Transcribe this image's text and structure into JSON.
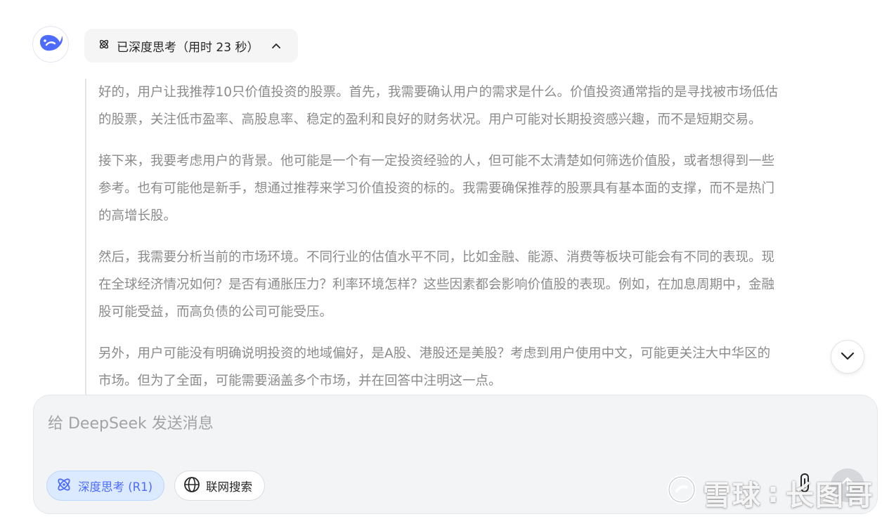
{
  "assistant": {
    "avatar_icon": "deepseek-whale-icon",
    "thinking_status": "已深度思考（用时 23 秒）",
    "thinking_icon": "atom-icon",
    "collapse_icon": "chevron-up-icon"
  },
  "thought": {
    "paragraphs": [
      [
        "好的，用户让我推荐10只价值投资的股票。首先，我需要确认用户的需求是什么。价值投资通常指的是寻找被市场低估",
        "的股票，关注低市盈率、高股息率、稳定的盈利和良好的财务状况。用户可能对长期投资感兴趣，而不是短期交易。"
      ],
      [
        "接下来，我要考虑用户的背景。他可能是一个有一定投资经验的人，但可能不太清楚如何筛选价值股，或者想得到一些",
        "参考。也有可能他是新手，想通过推荐来学习价值投资的标的。我需要确保推荐的股票具有基本面的支撑，而不是热门",
        "的高增长股。"
      ],
      [
        "然后，我需要分析当前的市场环境。不同行业的估值水平不同，比如金融、能源、消费等板块可能会有不同的表现。现",
        "在全球经济情况如何？是否有通胀压力？利率环境怎样？这些因素都会影响价值股的表现。例如，在加息周期中，金融",
        "股可能受益，而高负债的公司可能受压。"
      ],
      [
        "另外，用户可能没有明确说明投资的地域偏好，是A股、港股还是美股？考虑到用户使用中文，可能更关注大中华区的",
        "市场。但为了全面，可能需要涵盖多个市场，并在回答中注明这一点。"
      ]
    ]
  },
  "scroll_button_icon": "chevron-down-icon",
  "composer": {
    "placeholder": "给 DeepSeek 发送消息",
    "deep_think_label": "深度思考 (R1)",
    "deep_think_icon": "atom-icon",
    "web_search_label": "联网搜索",
    "web_search_icon": "globe-icon",
    "attach_icon": "paperclip-icon",
    "send_icon": "arrow-up-icon"
  },
  "watermark": {
    "brand": "雪球",
    "author": "长图哥"
  },
  "colors": {
    "accent": "#4d6bfe",
    "thought_text": "#8b8b8b",
    "composer_bg": "#f3f4f6"
  }
}
